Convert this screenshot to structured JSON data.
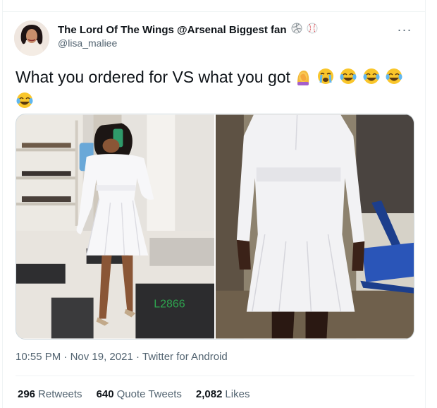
{
  "tweet": {
    "display_name": "The Lord Of The Wings @Arsenal Biggest fan",
    "name_badges": [
      "volleyball-icon",
      "baseball-icon"
    ],
    "handle": "@lisa_maliee",
    "more_label": "···",
    "text": "What you ordered for VS what you got",
    "emojis": [
      "woman-facepalming-emoji",
      "loudly-crying-face-emoji",
      "tears-of-joy-emoji",
      "tears-of-joy-emoji",
      "tears-of-joy-emoji",
      "tears-of-joy-emoji"
    ],
    "photo_watermark": "L2866",
    "time": "10:55 PM",
    "separator": "·",
    "date": "Nov 19, 2021",
    "source": "Twitter for Android",
    "retweets_count": "296",
    "retweets_label": "Retweets",
    "quotes_count": "640",
    "quotes_label": "Quote Tweets",
    "likes_count": "2,082",
    "likes_label": "Likes"
  },
  "colors": {
    "text_primary": "#0f1419",
    "text_secondary": "#536471",
    "divider": "#eff3f4",
    "watermark_green": "#2ea44f"
  }
}
